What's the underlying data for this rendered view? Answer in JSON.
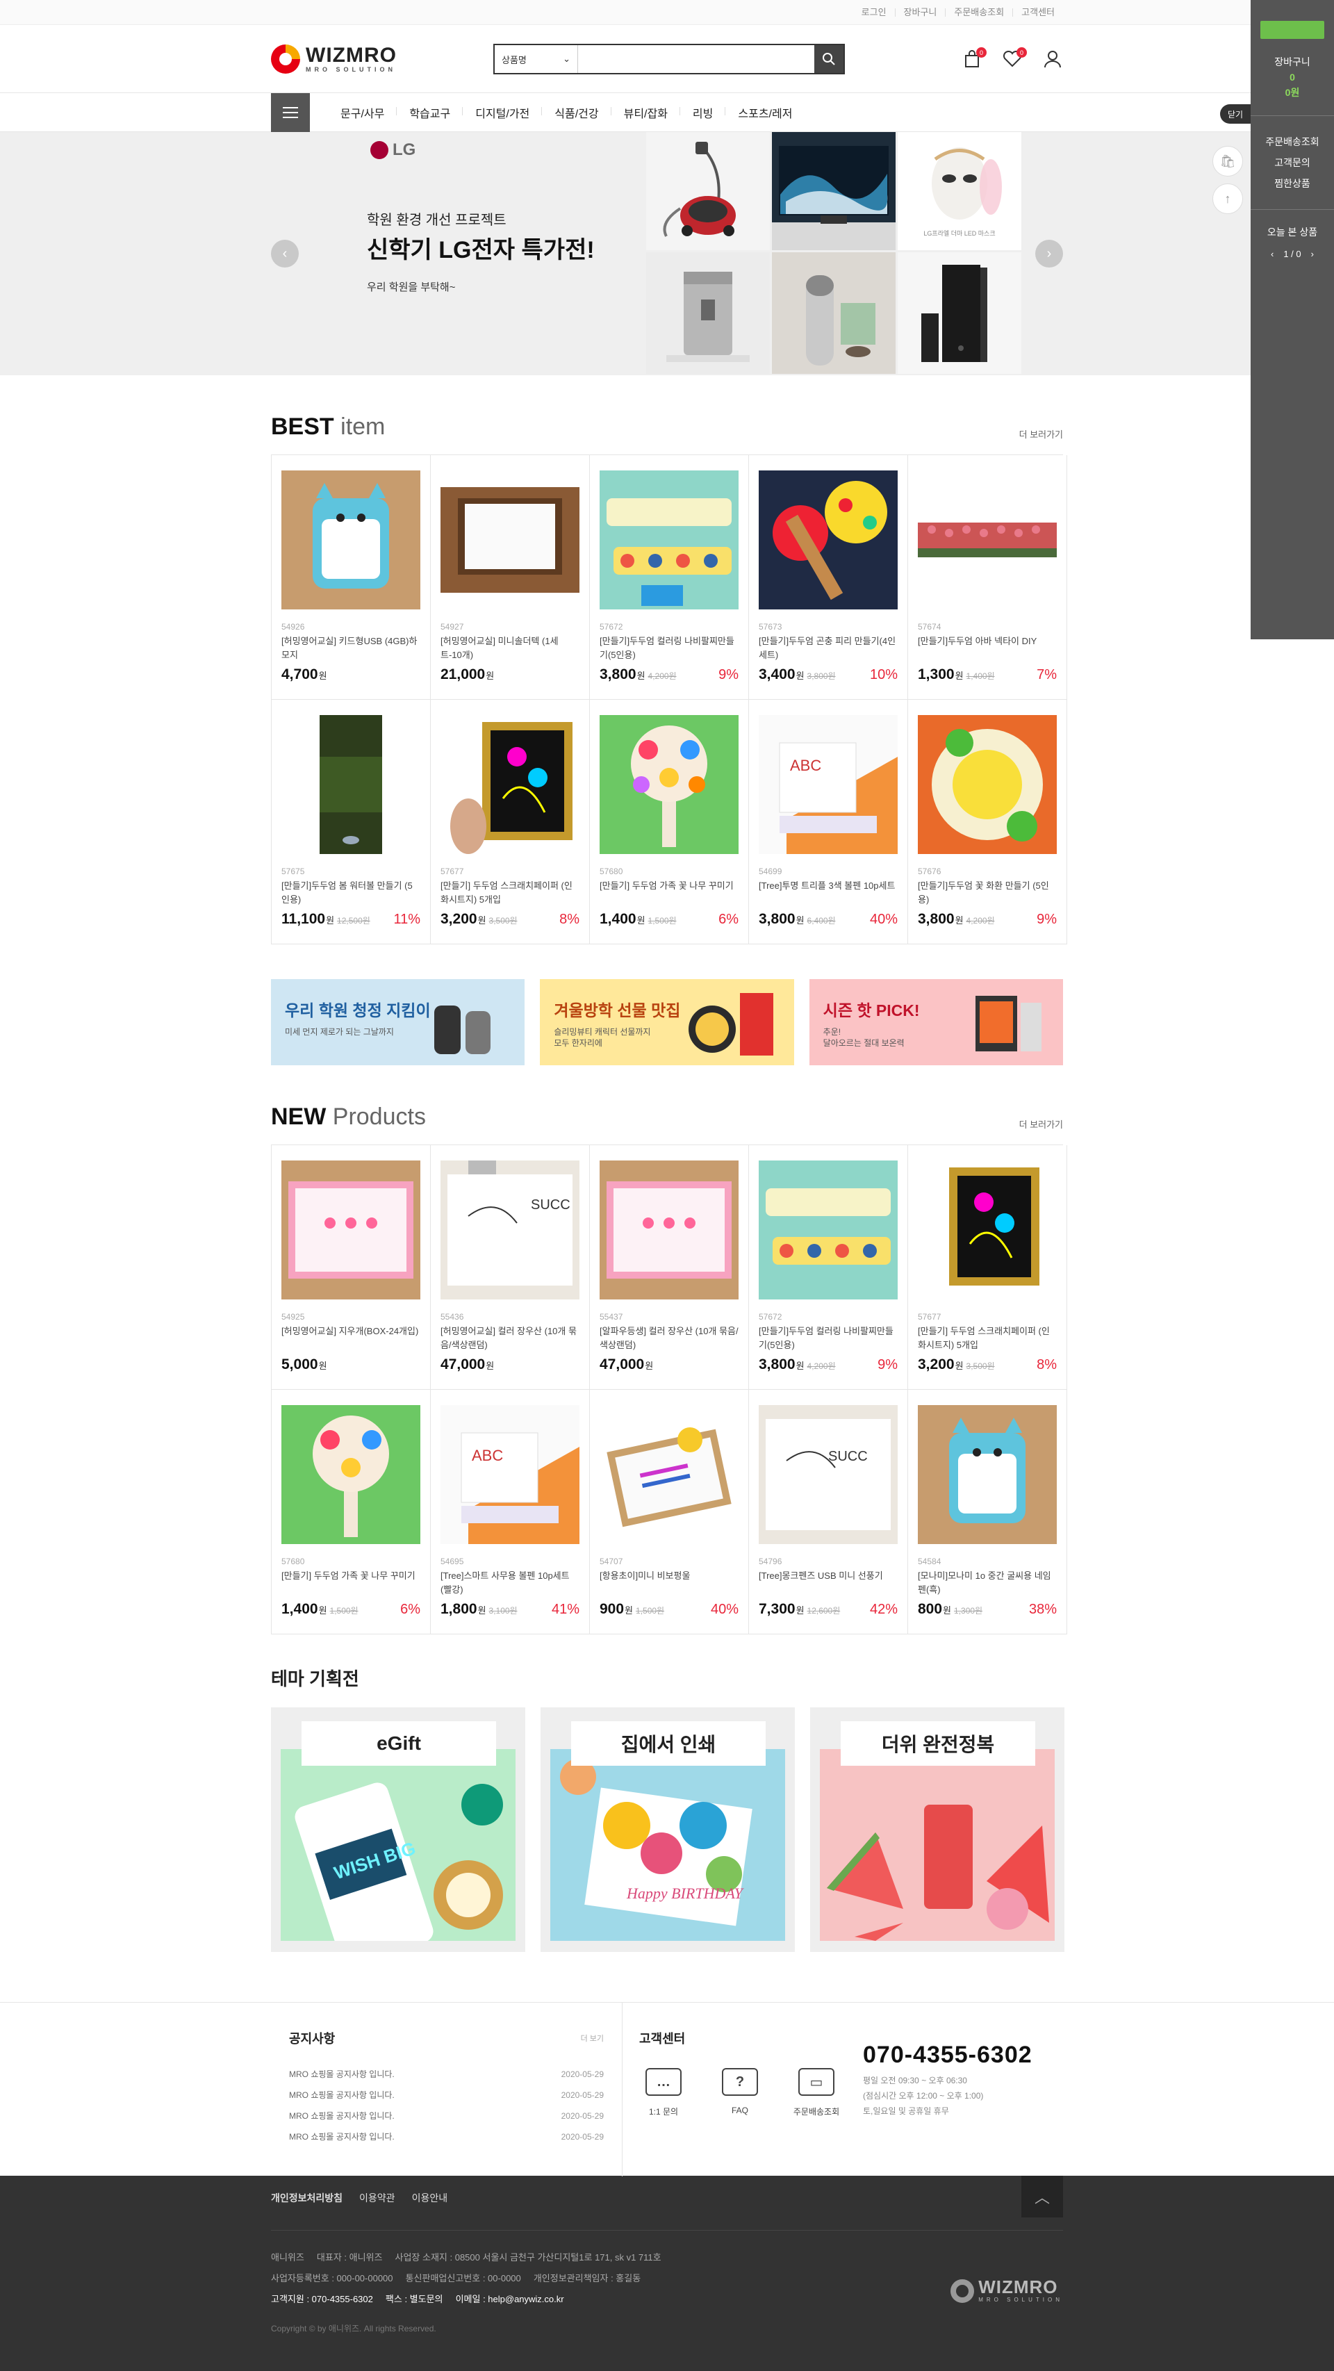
{
  "topbar": {
    "links": [
      "로그인",
      "장바구니",
      "주문배송조회",
      "고객센터"
    ]
  },
  "logo": {
    "name": "WIZMRO",
    "tagline": "MRO SOLUTION"
  },
  "search": {
    "category": "상품명",
    "placeholder": ""
  },
  "header": {
    "cart_count": "0",
    "wish_count": "0"
  },
  "gnb": [
    "문구/사무",
    "학습교구",
    "디지털/가전",
    "식품/건강",
    "뷰티/잡화",
    "리빙",
    "스포츠/레저"
  ],
  "hero": {
    "brand": "LG",
    "subtitle": "학원 환경 개선 프로젝트",
    "title": "신학기 LG전자 특가전!",
    "desc": "우리 학원을 부탁해~",
    "tile_caption": "LG프라엘 더마 LED 마스크"
  },
  "quick": {
    "cart_label": "장바구니",
    "cart_count": "0",
    "cart_total": "0원",
    "links": [
      "주문배송조회",
      "고객문의",
      "찜한상품"
    ],
    "today": "오늘 본 상품",
    "pager": "1 / 0",
    "close": "닫기",
    "float_badge": "0"
  },
  "best": {
    "title_bold": "BEST",
    "title_light": " item",
    "more": "더 보러가기",
    "items": [
      {
        "code": "54926",
        "name": "[허밍영어교실] 키드형USB (4GB)하모지",
        "price": "4,700",
        "orig": "",
        "pct": ""
      },
      {
        "code": "54927",
        "name": "[허밍영어교실] 미니솔더텍 (1세트-10개)",
        "price": "21,000",
        "orig": "",
        "pct": ""
      },
      {
        "code": "57672",
        "name": "[만들기]두두엄 컬러링 나비팔찌만들기(5인용)",
        "price": "3,800",
        "orig": "4,200원",
        "pct": "9%"
      },
      {
        "code": "57673",
        "name": "[만들기]두두엄 곤충 피리 만들기(4인세트)",
        "price": "3,400",
        "orig": "3,800원",
        "pct": "10%"
      },
      {
        "code": "57674",
        "name": "[만들기]두두엄 아바 넥타이 DIY",
        "price": "1,300",
        "orig": "1,400원",
        "pct": "7%"
      },
      {
        "code": "57675",
        "name": "[만들기]두두엄 봄 워터볼 만들기 (5인용)",
        "price": "11,100",
        "orig": "12,500원",
        "pct": "11%"
      },
      {
        "code": "57677",
        "name": "[만들기] 두두엄 스크래치페이퍼 (인화시트지) 5개입",
        "price": "3,200",
        "orig": "3,500원",
        "pct": "8%"
      },
      {
        "code": "57680",
        "name": "[만들기] 두두엄 가족 꽃 나무 꾸미기",
        "price": "1,400",
        "orig": "1,500원",
        "pct": "6%"
      },
      {
        "code": "54699",
        "name": "[Tree]투명 트리플 3색 볼펜 10p세트",
        "price": "3,800",
        "orig": "6,400원",
        "pct": "40%"
      },
      {
        "code": "57676",
        "name": "[만들기]두두엄 꽃 화환 만들기 (5인용)",
        "price": "3,800",
        "orig": "4,200원",
        "pct": "9%"
      }
    ]
  },
  "banners": [
    {
      "title": "우리 학원 청정 지킴이",
      "desc": "미세 먼지 제로가 되는 그날까지",
      "color": "#cfe6f3"
    },
    {
      "title": "겨울방학 선물 맛집",
      "desc": "슬리밍뷰티 캐릭터 선물까지\n모두 한자리에",
      "color": "#ffe89a"
    },
    {
      "title": "시즌 핫 PICK!",
      "desc": "추운!\n달아오르는 절대 보온력",
      "color": "#fbc3c5"
    }
  ],
  "new": {
    "title_bold": "NEW",
    "title_light": " Products",
    "more": "더 보러가기",
    "items": [
      {
        "code": "54925",
        "name": "[허밍영어교실] 지우개(BOX-24개입)",
        "price": "5,000",
        "orig": "",
        "pct": ""
      },
      {
        "code": "55436",
        "name": "[허밍영어교실] 컬러 장우산 (10개 묶음/색상랜덤)",
        "price": "47,000",
        "orig": "",
        "pct": ""
      },
      {
        "code": "55437",
        "name": "[알파우등생] 컬러 장우산 (10개 묶음/색상랜덤)",
        "price": "47,000",
        "orig": "",
        "pct": ""
      },
      {
        "code": "57672",
        "name": "[만들기]두두엄 컬러링 나비팔찌만들기(5인용)",
        "price": "3,800",
        "orig": "4,200원",
        "pct": "9%"
      },
      {
        "code": "57677",
        "name": "[만들기] 두두엄 스크래치페이퍼 (인화시트지) 5개입",
        "price": "3,200",
        "orig": "3,500원",
        "pct": "8%"
      },
      {
        "code": "57680",
        "name": "[만들기] 두두엄 가족 꽃 나무 꾸미기",
        "price": "1,400",
        "orig": "1,500원",
        "pct": "6%"
      },
      {
        "code": "54695",
        "name": "[Tree]스마트 사무용 볼펜 10p세트 (빨강)",
        "price": "1,800",
        "orig": "3,100원",
        "pct": "41%"
      },
      {
        "code": "54707",
        "name": "[항용초이]미니 비보펑울",
        "price": "900",
        "orig": "1,500원",
        "pct": "40%"
      },
      {
        "code": "54796",
        "name": "[Tree]몽크펜즈 USB 미니 선풍기",
        "price": "7,300",
        "orig": "12,600원",
        "pct": "42%"
      },
      {
        "code": "54584",
        "name": "[모나미]모나미 1o 중간 굴씨용 네임펜(흑)",
        "price": "800",
        "orig": "1,300원",
        "pct": "38%"
      }
    ]
  },
  "theme": {
    "title": "테마 기획전",
    "items": [
      {
        "label": "eGift",
        "card_text": "WISH BIG"
      },
      {
        "label": "집에서 인쇄",
        "card_text": "Happy BIRTHDAY"
      },
      {
        "label": "더위 완전정복",
        "card_text": ""
      }
    ]
  },
  "notice": {
    "title": "공지사항",
    "more": "더 보기",
    "items": [
      {
        "text": "MRO 쇼핑몰 공지사항 입니다.",
        "date": "2020-05-29"
      },
      {
        "text": "MRO 쇼핑몰 공지사항 입니다.",
        "date": "2020-05-29"
      },
      {
        "text": "MRO 쇼핑몰 공지사항 입니다.",
        "date": "2020-05-29"
      },
      {
        "text": "MRO 쇼핑몰 공지사항 입니다.",
        "date": "2020-05-29"
      }
    ]
  },
  "cs": {
    "title": "고객센터",
    "icons": [
      "1:1 문의",
      "FAQ",
      "주문배송조회"
    ],
    "tel": "070-4355-6302",
    "hours1": "평일 오전 09:30 ~ 오후 06:30",
    "hours2": "(점심시간 오후 12:00 ~ 오후 1:00)",
    "hours3": "토,일요일 및 공휴일 휴무"
  },
  "footer": {
    "links": [
      "개인정보처리방침",
      "이용약관",
      "이용안내"
    ],
    "line1": "애니위즈     대표자 : 애니위즈     사업장 소재지 : 08500 서울시 금천구 가산디지털1로 171, sk v1 711호",
    "line2": "사업자등록번호 : 000-00-00000     통신판매업신고번호 : 00-0000     개인정보관리책임자 : 홍길동",
    "line3": "고객지원 : 070-4355-6302     팩스 : 별도문의     이메일 : help@anywiz.co.kr",
    "copyright": "Copyright © by 애니위즈. All rights Reserved."
  }
}
